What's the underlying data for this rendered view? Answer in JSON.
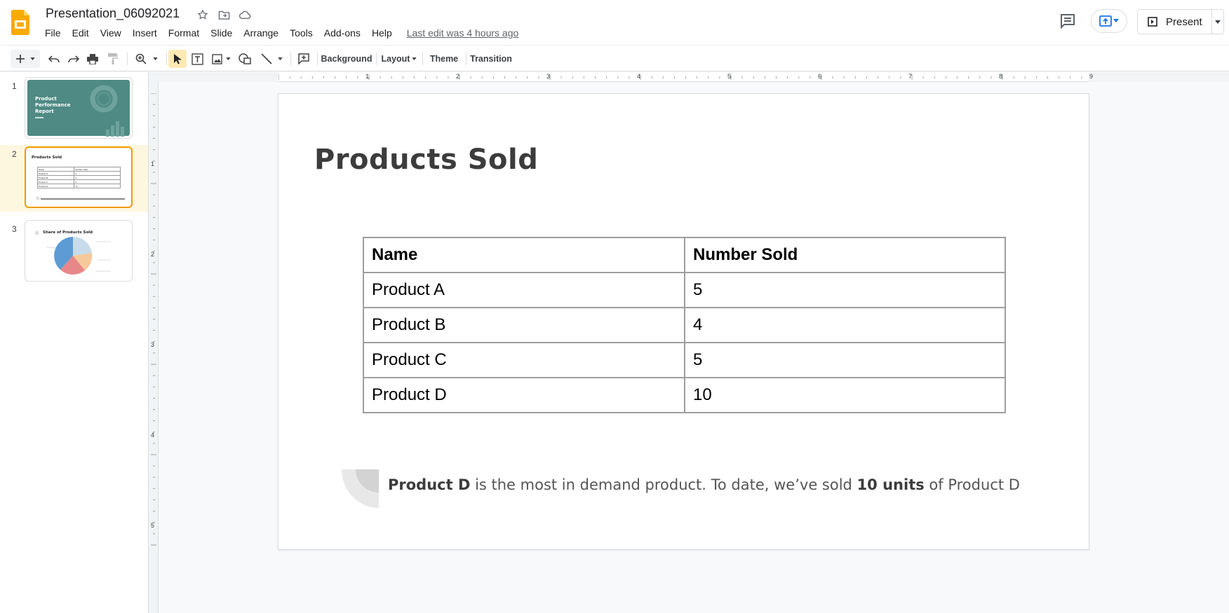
{
  "header": {
    "doc_title": "Presentation_06092021",
    "last_edit": "Last edit was 4 hours ago",
    "present_label": "Present"
  },
  "menu": [
    "File",
    "Edit",
    "View",
    "Insert",
    "Format",
    "Slide",
    "Arrange",
    "Tools",
    "Add-ons",
    "Help"
  ],
  "toolbar": {
    "background_label": "Background",
    "layout_label": "Layout",
    "theme_label": "Theme",
    "transition_label": "Transition"
  },
  "filmstrip": {
    "slides": [
      {
        "number": "1",
        "title": "Product Performance Report"
      },
      {
        "number": "2",
        "title": "Products Sold"
      },
      {
        "number": "3",
        "title": "Share of Products Sold"
      }
    ],
    "selected": 2
  },
  "rulers": {
    "horizontal": [
      "1",
      "2",
      "3",
      "4",
      "5",
      "6",
      "7",
      "8",
      "9"
    ],
    "vertical": [
      "1",
      "2",
      "3",
      "4",
      "5"
    ]
  },
  "slide": {
    "title": "Products Sold",
    "table": {
      "headers": [
        "Name",
        "Number Sold"
      ],
      "rows": [
        [
          "Product A",
          "5"
        ],
        [
          "Product B",
          "4"
        ],
        [
          "Product C",
          "5"
        ],
        [
          "Product D",
          "10"
        ]
      ]
    },
    "callout": {
      "part1_bold": "Product D",
      "part2": " is the most in demand product. To date, we’ve sold ",
      "part3_bold": "10 units",
      "part4": " of Product D"
    }
  },
  "colors": {
    "accent_selected": "#f29900",
    "thumb_title_bg": "#4f8a84",
    "share_blue": "#1a73e8",
    "logo_yellow": "#f9ab00"
  },
  "icons": [
    "slides-logo-icon",
    "star-icon",
    "move-folder-icon",
    "cloud-saved-icon",
    "comments-icon",
    "share-upload-icon",
    "present-icon",
    "chevron-down-icon"
  ]
}
